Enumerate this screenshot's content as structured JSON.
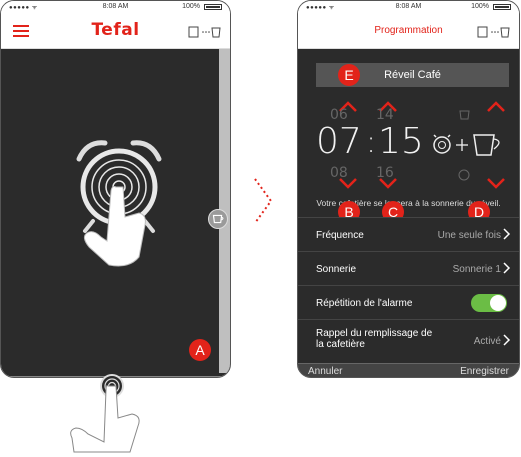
{
  "status_bar": {
    "signal": "●●●●● ᯤ",
    "time": "8:08 AM",
    "battery": "100%"
  },
  "screen1": {
    "brand": "Tefal",
    "badge_a": "A"
  },
  "screen2": {
    "title": "Programmation",
    "alarm_name": "Réveil Café",
    "hours": {
      "prev": "06",
      "current": "07",
      "next": "08"
    },
    "minutes": {
      "prev": "14",
      "current": "15",
      "next": "16"
    },
    "separator": ":",
    "hint": "Votre cafetière se lancera à la sonnerie du réveil.",
    "badges": {
      "e": "E",
      "b": "B",
      "c": "C",
      "d": "D"
    },
    "rows": [
      {
        "label": "Fréquence",
        "value": "Une seule fois"
      },
      {
        "label": "Sonnerie",
        "value": "Sonnerie 1"
      },
      {
        "label": "Répétition de l'alarme",
        "value": ""
      },
      {
        "label": "Rappel du remplissage de la cafetière",
        "value": "Activé"
      }
    ],
    "cancel": "Annuler",
    "save": "Enregistrer"
  },
  "colors": {
    "accent": "#e2231a",
    "toggle_on": "#6bbd45",
    "dark_bg": "#2b2b2b"
  },
  "icons": [
    "menu-icon",
    "coffee-maker-icon",
    "alarm-clock-icon",
    "plus-icon",
    "chevron-right-icon",
    "arrow-up-icon",
    "arrow-down-icon",
    "hand-tap-icon"
  ]
}
